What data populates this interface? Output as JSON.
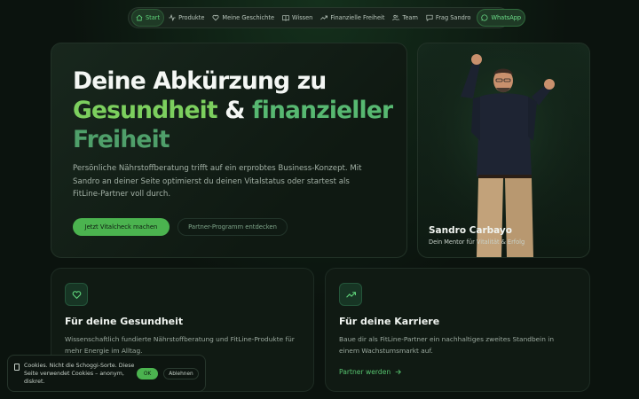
{
  "nav": {
    "items": [
      {
        "label": "Start",
        "icon": "home-icon",
        "active": true
      },
      {
        "label": "Produkte",
        "icon": "activity-icon"
      },
      {
        "label": "Meine Geschichte",
        "icon": "heart-icon"
      },
      {
        "label": "Wissen",
        "icon": "book-icon"
      },
      {
        "label": "Finanzielle Freiheit",
        "icon": "trending-up-icon"
      },
      {
        "label": "Team",
        "icon": "users-icon"
      },
      {
        "label": "Frag Sandro",
        "icon": "chat-icon"
      }
    ],
    "whatsapp": {
      "label": "WhatsApp",
      "icon": "whatsapp-icon"
    }
  },
  "hero": {
    "title_line1": "Deine Abkürzung zu",
    "title_green1": "Gesundheit",
    "title_amp": " & ",
    "title_green2": "finanzieller",
    "title_green3": "Freiheit",
    "description": "Persönliche Nährstoffberatung trifft auf ein erprobtes Business-Konzept. Mit Sandro an deiner Seite optimierst du deinen Vitalstatus oder startest als FitLine-Partner voll durch.",
    "cta_primary": "Jetzt Vitalcheck machen",
    "cta_secondary": "Partner-Programm entdecken"
  },
  "person": {
    "name": "Sandro Carbayo",
    "role": "Dein Mentor für Vitalität & Erfolg"
  },
  "features": [
    {
      "icon": "heart-icon",
      "title": "Für deine Gesundheit",
      "text": "Wissenschaftlich fundierte Nährstoffberatung und FitLine-Produkte für mehr Energie im Alltag."
    },
    {
      "icon": "trending-up-icon",
      "title": "Für deine Karriere",
      "text": "Baue dir als FitLine-Partner ein nachhaltiges zweites Standbein in einem Wachstumsmarkt auf.",
      "link": "Partner werden"
    }
  ],
  "cookie": {
    "text": "Cookies. Nicht die Schoggi-Sorte. Diese Seite verwendet Cookies – anonym, diskret.",
    "accept": "OK",
    "decline": "Ablehnen"
  },
  "colors": {
    "background": "#0b130e",
    "accent": "#4bb34f",
    "accent_text": "#57c46f"
  }
}
